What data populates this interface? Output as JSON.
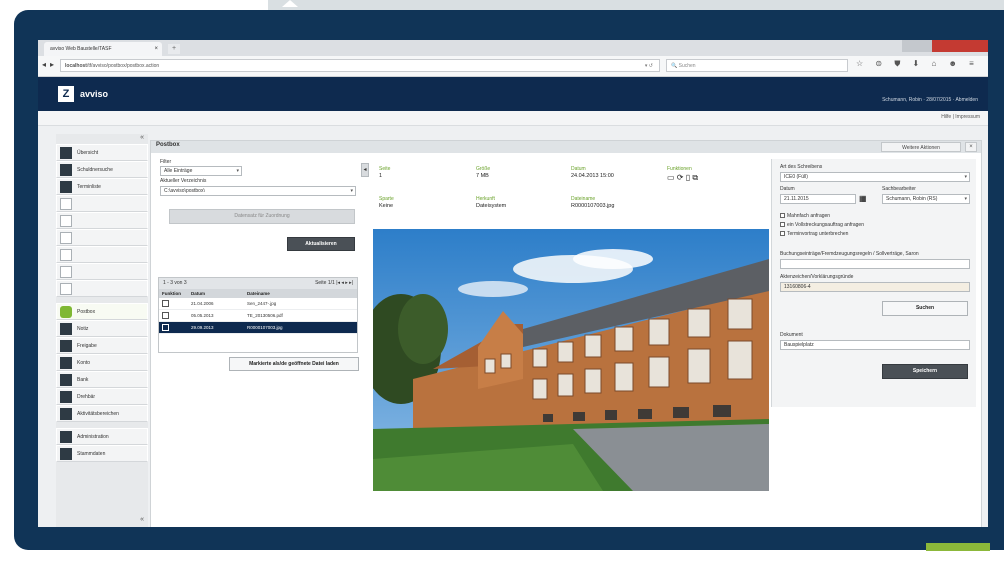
{
  "browser": {
    "tab_title": "avviso Web Baustelle/TASF",
    "tab_close": "×",
    "new_tab": "+",
    "url_host": "localhost",
    "url_path": "/tf/avviso/postbox/postbox.action",
    "url_dropdown": "▾  ↺",
    "search_placeholder": "Suchen",
    "toolbar_icons": "☆ ⊜ ⛊ ⬇ ⌂ ☻ ≡",
    "back": "◂",
    "forward": "▸"
  },
  "app": {
    "brand": "avviso",
    "logo_glyph": "Z",
    "user_line": "Schumann, Robin · 28/07/2015 · Abmelden",
    "help_line": "Hilfe | Impressum"
  },
  "sidebar": {
    "collapse_top": "«",
    "collapse_bottom": "«",
    "items": [
      {
        "label": "Übersicht",
        "placeholder": false
      },
      {
        "label": "Schuldnersuche",
        "placeholder": false
      },
      {
        "label": "Terminliste",
        "placeholder": false
      },
      {
        "label": "",
        "placeholder": true
      },
      {
        "label": "",
        "placeholder": true
      },
      {
        "label": "",
        "placeholder": true
      },
      {
        "label": "",
        "placeholder": true
      },
      {
        "label": "",
        "placeholder": true
      },
      {
        "label": "",
        "placeholder": true
      },
      {
        "label": "Postbox",
        "placeholder": false,
        "active": true
      },
      {
        "label": "Notiz",
        "placeholder": false
      },
      {
        "label": "Freigabe",
        "placeholder": false
      },
      {
        "label": "Konto",
        "placeholder": false
      },
      {
        "label": "Bank",
        "placeholder": false
      },
      {
        "label": "Drehbär",
        "placeholder": false
      },
      {
        "label": "Aktivitätsbereichen",
        "placeholder": false
      },
      {
        "label": "Administration",
        "placeholder": false
      },
      {
        "label": "Stammdaten",
        "placeholder": false
      }
    ]
  },
  "main": {
    "title": "Postbox",
    "header_button": "Weitere Aktionen",
    "close": "×",
    "filter_label": "Filter",
    "filter_value": "Alle Einträge",
    "mailbox_label": "Aktueller Verzeichnis",
    "mailbox_value": "C:\\avviso\\postbox\\",
    "assign_button": "Datensatz für Zuordnung",
    "refresh_button": "Aktualisieren",
    "collapse_glyph": "◂",
    "grid": {
      "count": "1 - 3 von 3",
      "pager": "Seite  1/1   |◂  ◂  ▸  ▸|",
      "headers": [
        "Funktion",
        "Datum",
        "Dateiname"
      ],
      "rows": [
        {
          "date": "21.04.2006",
          "name": "Sen_2447-.jpg"
        },
        {
          "date": "05.05.2013",
          "name": "TE_20130506.pdf"
        },
        {
          "date": "29.09.2013",
          "name": "R0000107003.jpg",
          "selected": true
        }
      ]
    },
    "load_button": "Markierte als/de geöffnete Datei laden",
    "meta": {
      "seite_label": "Seite",
      "seite_value": "1",
      "groesse_label": "Größe",
      "groesse_value": "7 MB",
      "datum_label": "Datum",
      "datum_value": "24.04.2013 15:00",
      "funktionen_label": "Funktionen",
      "funktionen_value": "▭ ⟳ ▯ ⧉",
      "sparte_label": "Sparte",
      "sparte_value": "Keine",
      "herkunft_label": "Herkunft",
      "herkunft_value": "Dateisystem",
      "dateiname_label": "Dateiname",
      "dateiname_value": "R0000107003.jpg"
    }
  },
  "right_panel": {
    "type_label": "Art des Schreibens",
    "type_value": "ICE0 (Füll)",
    "datum_label": "Datum",
    "datum_value": "21.11.2015",
    "sb_label": "Sachbearbeiter",
    "sb_value": "Schumann, Robin (RS)",
    "cb1": "Mahnfach anfragen",
    "cb2": "ein Vollstreckungsauftrag anfragen",
    "cb3": "Terminvortrag unterbrechen",
    "ref_label": "Buchungseinträge/Fremdzeugungsregeln / Sollverträge, Saron",
    "ref_value": "",
    "acct_label": "Aktenzeichen/Vorklärungsgründe",
    "acct_value": "13160806-4",
    "search_button": "Suchen",
    "subject_label": "Dokument",
    "subject_value": "Bauspielplatz",
    "save_button": "Speichern"
  },
  "colors": {
    "frame": "#103457",
    "app_header": "#0e2a4f",
    "accent_green": "#7fb833",
    "meta_label": "#6aa22a"
  }
}
